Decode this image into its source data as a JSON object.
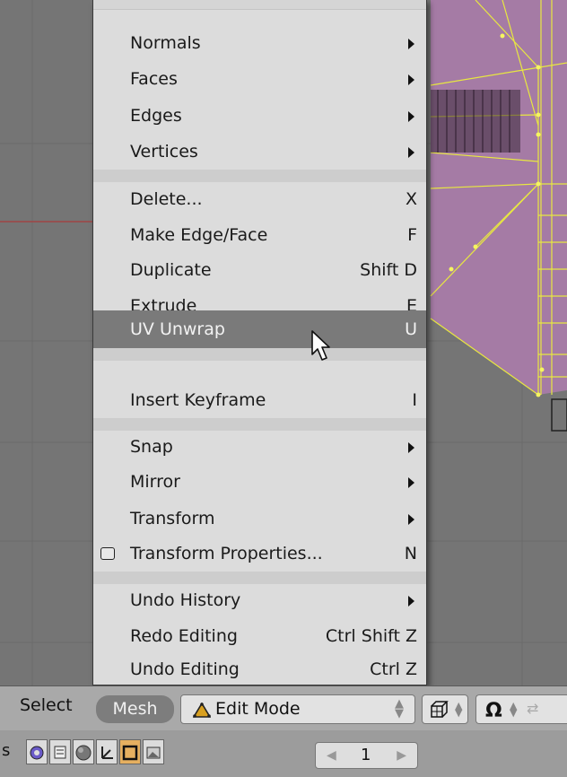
{
  "menu": {
    "items": [
      {
        "label": "Normals",
        "shortcut": "",
        "submenu": true
      },
      {
        "label": "Faces",
        "shortcut": "",
        "submenu": true
      },
      {
        "label": "Edges",
        "shortcut": "",
        "submenu": true
      },
      {
        "label": "Vertices",
        "shortcut": "",
        "submenu": true
      },
      {
        "label": "Delete...",
        "shortcut": "X",
        "submenu": false
      },
      {
        "label": "Make Edge/Face",
        "shortcut": "F",
        "submenu": false
      },
      {
        "label": "Duplicate",
        "shortcut": "Shift D",
        "submenu": false
      },
      {
        "label": "Extrude",
        "shortcut": "E",
        "submenu": false
      },
      {
        "label": "UV Unwrap",
        "shortcut": "U",
        "submenu": false,
        "highlighted": true
      },
      {
        "label": "Insert Keyframe",
        "shortcut": "I",
        "submenu": false
      },
      {
        "label": "Snap",
        "shortcut": "",
        "submenu": true
      },
      {
        "label": "Mirror",
        "shortcut": "",
        "submenu": true
      },
      {
        "label": "Transform",
        "shortcut": "",
        "submenu": true
      },
      {
        "label": "Transform Properties...",
        "shortcut": "N",
        "submenu": false,
        "checkbox": true
      },
      {
        "label": "Undo History",
        "shortcut": "",
        "submenu": true
      },
      {
        "label": "Redo Editing",
        "shortcut": "Ctrl Shift Z",
        "submenu": false
      },
      {
        "label": "Undo Editing",
        "shortcut": "Ctrl Z",
        "submenu": false
      }
    ]
  },
  "header": {
    "select_label": "Select",
    "mesh_label": "Mesh",
    "mode_value": "Edit Mode"
  },
  "bottom": {
    "frame_value": "1",
    "left_edge_char": "s"
  },
  "colors": {
    "mesh_fill": "#a57ba5",
    "wire": "#f0f040",
    "highlight": "#7a7a7a"
  }
}
